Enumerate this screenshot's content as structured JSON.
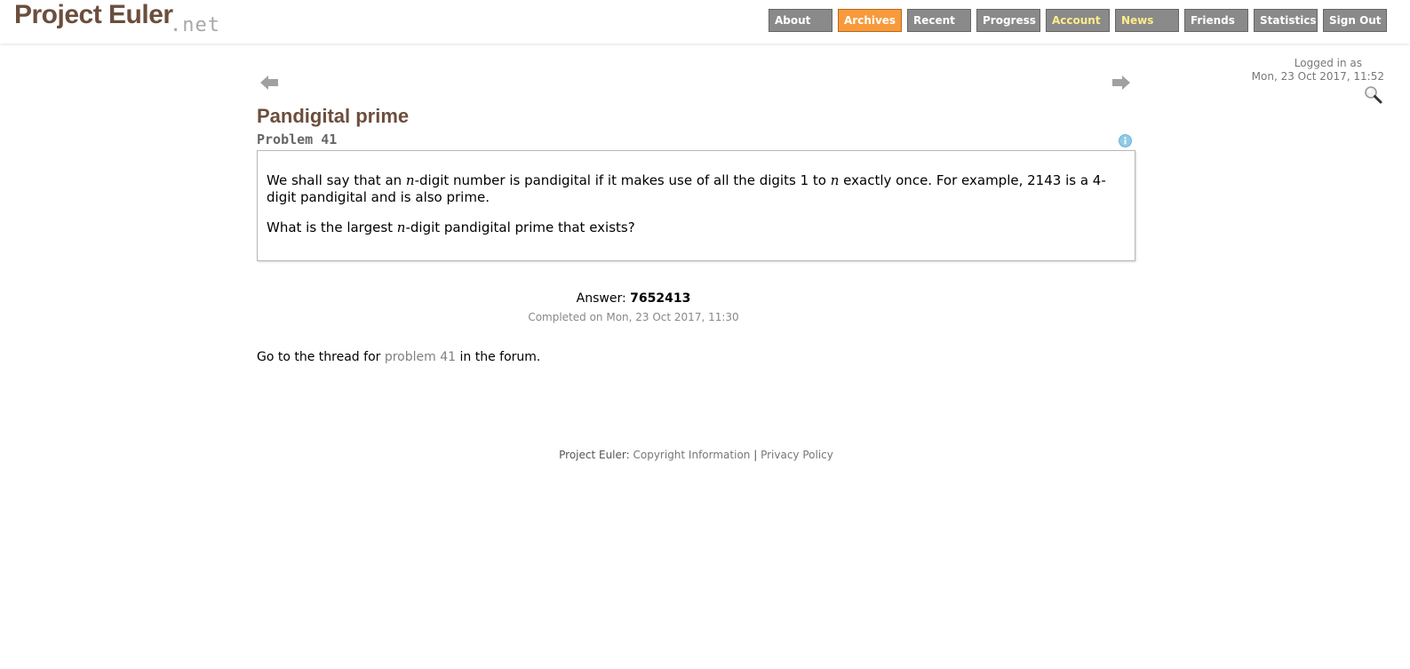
{
  "logo": {
    "main": "Project Euler",
    "suffix": ".net"
  },
  "nav": [
    {
      "label": "About"
    },
    {
      "label": "Archives",
      "state": "active"
    },
    {
      "label": "Recent"
    },
    {
      "label": "Progress"
    },
    {
      "label": "Account",
      "state": "highlight"
    },
    {
      "label": "News",
      "state": "highlight"
    },
    {
      "label": "Friends"
    },
    {
      "label": "Statistics"
    },
    {
      "label": "Sign Out"
    }
  ],
  "user": {
    "logged_in_label": "Logged in as",
    "timestamp": "Mon, 23 Oct 2017, 11:52"
  },
  "icons": {
    "prev": "left-arrow-icon",
    "next": "right-arrow-icon",
    "info": "info-icon",
    "search": "magnifier-icon"
  },
  "problem": {
    "title": "Pandigital prime",
    "number_label": "Problem 41",
    "p1_a": "We shall say that an ",
    "p1_n1": "n",
    "p1_b": "-digit number is pandigital if it makes use of all the digits 1 to ",
    "p1_n2": "n",
    "p1_c": " exactly once. For example, 2143 is a 4-digit pandigital and is also prime.",
    "p2_a": "What is the largest ",
    "p2_n": "n",
    "p2_b": "-digit pandigital prime that exists?"
  },
  "answer": {
    "label": "Answer: ",
    "value": "7652413",
    "completed": "Completed on Mon, 23 Oct 2017, 11:30"
  },
  "forum": {
    "prefix": "Go to the thread for ",
    "link": "problem 41",
    "suffix": " in the forum."
  },
  "footer": {
    "prefix": "Project Euler: ",
    "copyright": "Copyright Information",
    "separator": " | ",
    "privacy": "Privacy Policy"
  },
  "colors": {
    "brand": "#6b4e3d",
    "nav_bg": "#8a8a8a",
    "nav_active": "#f79a3c",
    "nav_highlight_text": "#ffec8b",
    "link_gray": "#808080"
  }
}
